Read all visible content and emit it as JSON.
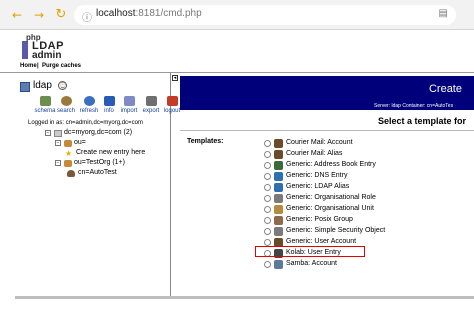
{
  "browser": {
    "url_host": "localhost",
    "url_path": ":8181/cmd.php"
  },
  "logo": {
    "php": "php",
    "ldap": "LDAP",
    "admin": "admin"
  },
  "menu": {
    "home": "Home",
    "separator": "|",
    "purge": "Purge caches"
  },
  "tree": {
    "server_name": "ldap",
    "toolbar": [
      "schema",
      "search",
      "refresh",
      "info",
      "import",
      "export",
      "logout"
    ],
    "logged_in": "Logged in as: cn=admin,dc=myorg,dc=com",
    "nodes": [
      {
        "toggle": "−",
        "label": "dc=myorg,dc=com (2)"
      },
      {
        "toggle": "−",
        "label": "ou="
      },
      {
        "toggle": "",
        "label": "Create new entry here"
      },
      {
        "toggle": "−",
        "label": "ou=TestOrg (1+)"
      },
      {
        "toggle": "",
        "label": "cn=AutoTest"
      }
    ]
  },
  "main": {
    "title": "Create",
    "subtitle": "Server: ldap   Container: cn=AutoTes",
    "heading": "Select a template for",
    "templates_label": "Templates:",
    "templates": [
      {
        "label": "Courier Mail: Account",
        "icon": "person-icon"
      },
      {
        "label": "Courier Mail: Alias",
        "icon": "person-icon"
      },
      {
        "label": "Generic: Address Book Entry",
        "icon": "address-book-icon"
      },
      {
        "label": "Generic: DNS Entry",
        "icon": "globe-icon"
      },
      {
        "label": "Generic: LDAP Alias",
        "icon": "link-icon"
      },
      {
        "label": "Generic: Organisational Role",
        "icon": "role-icon"
      },
      {
        "label": "Generic: Organisational Unit",
        "icon": "ou-icon"
      },
      {
        "label": "Generic: Posix Group",
        "icon": "group-icon"
      },
      {
        "label": "Generic: Simple Security Object",
        "icon": "key-icon"
      },
      {
        "label": "Generic: User Account",
        "icon": "person-icon"
      },
      {
        "label": "Kolab: User Entry",
        "icon": "kolab-icon"
      },
      {
        "label": "Samba: Account",
        "icon": "samba-icon"
      }
    ]
  },
  "colors": {
    "title_bar": "#00007a",
    "highlight": "#e00000",
    "link": "#1a3fa0"
  }
}
